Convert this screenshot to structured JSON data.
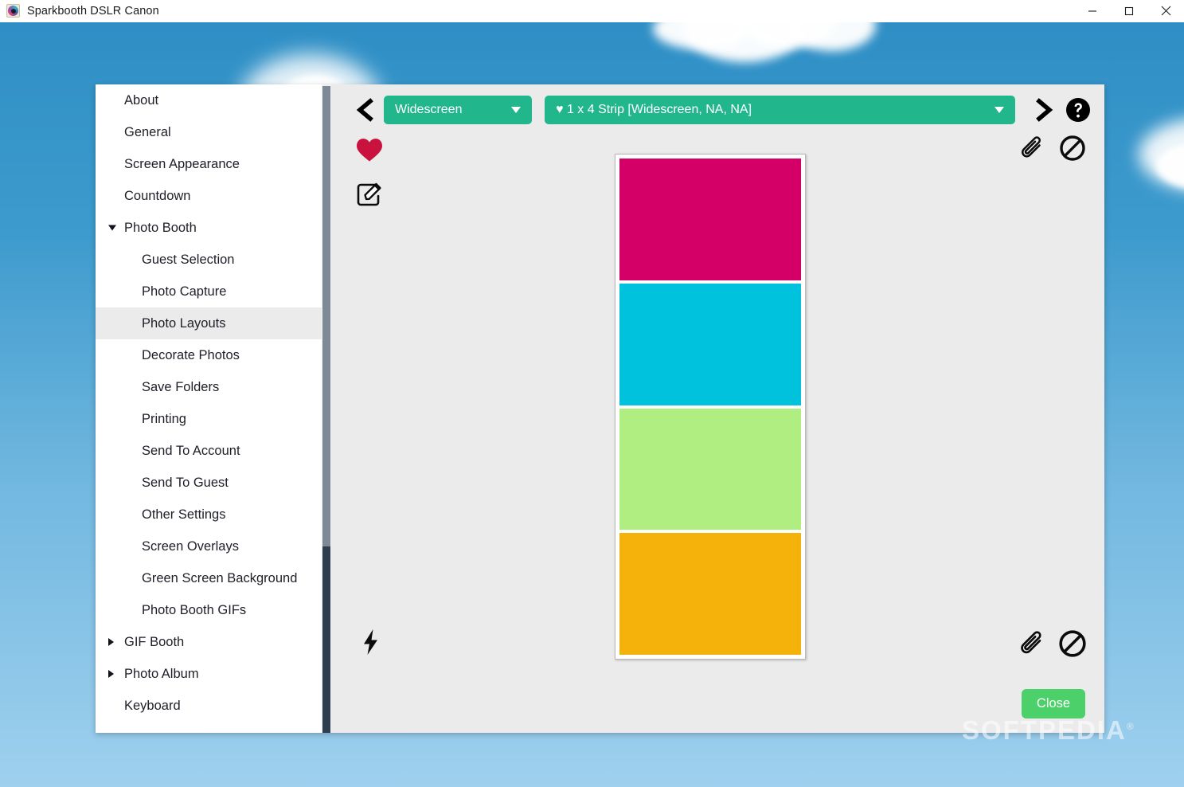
{
  "window": {
    "title": "Sparkbooth DSLR Canon",
    "app_icon": "camera-lens-icon",
    "controls": {
      "minimize": "minimize-icon",
      "maximize": "maximize-icon",
      "close": "close-icon"
    }
  },
  "sidebar": {
    "items": [
      {
        "label": "About",
        "level": 0,
        "expander": "none",
        "selected": false
      },
      {
        "label": "General",
        "level": 0,
        "expander": "none",
        "selected": false
      },
      {
        "label": "Screen Appearance",
        "level": 0,
        "expander": "none",
        "selected": false
      },
      {
        "label": "Countdown",
        "level": 0,
        "expander": "none",
        "selected": false
      },
      {
        "label": "Photo Booth",
        "level": 0,
        "expander": "expanded",
        "selected": false
      },
      {
        "label": "Guest Selection",
        "level": 1,
        "expander": "none",
        "selected": false
      },
      {
        "label": "Photo Capture",
        "level": 1,
        "expander": "none",
        "selected": false
      },
      {
        "label": "Photo Layouts",
        "level": 1,
        "expander": "none",
        "selected": true
      },
      {
        "label": "Decorate Photos",
        "level": 1,
        "expander": "none",
        "selected": false
      },
      {
        "label": "Save Folders",
        "level": 1,
        "expander": "none",
        "selected": false
      },
      {
        "label": "Printing",
        "level": 1,
        "expander": "none",
        "selected": false
      },
      {
        "label": "Send To Account",
        "level": 1,
        "expander": "none",
        "selected": false
      },
      {
        "label": "Send To Guest",
        "level": 1,
        "expander": "none",
        "selected": false
      },
      {
        "label": "Other Settings",
        "level": 1,
        "expander": "none",
        "selected": false
      },
      {
        "label": "Screen Overlays",
        "level": 1,
        "expander": "none",
        "selected": false
      },
      {
        "label": "Green Screen Background",
        "level": 1,
        "expander": "none",
        "selected": false
      },
      {
        "label": "Photo Booth GIFs",
        "level": 1,
        "expander": "none",
        "selected": false
      },
      {
        "label": "GIF Booth",
        "level": 0,
        "expander": "collapsed",
        "selected": false
      },
      {
        "label": "Photo Album",
        "level": 0,
        "expander": "collapsed",
        "selected": false
      },
      {
        "label": "Keyboard",
        "level": 0,
        "expander": "none",
        "selected": false
      }
    ]
  },
  "toolbar": {
    "back_icon": "chevron-left-icon",
    "mode_select": {
      "value": "Widescreen",
      "caret": "chevron-down-icon"
    },
    "layout_select": {
      "value": "♥ 1 x 4 Strip [Widescreen, NA, NA]",
      "caret": "chevron-down-icon"
    },
    "forward_icon": "chevron-right-icon",
    "help_icon": "help-circle-icon"
  },
  "left_tools": [
    {
      "name": "favorite-heart-icon",
      "color": "#c9133e"
    },
    {
      "name": "edit-layout-icon",
      "color": "#111111"
    }
  ],
  "right_tools_top": [
    {
      "name": "attach-paperclip-icon"
    },
    {
      "name": "disable-prohibited-icon"
    }
  ],
  "bottom_left_tools": [
    {
      "name": "lightning-bolt-icon"
    }
  ],
  "bottom_right_tools": [
    {
      "name": "attach-paperclip-icon"
    },
    {
      "name": "disable-prohibited-icon"
    }
  ],
  "footer": {
    "close_label": "Close",
    "close_color": "#4bd06a"
  },
  "preview": {
    "layout_name": "1 x 4 Strip",
    "frame_color": "#ffffff",
    "cells": [
      {
        "index": 1,
        "color": "#d40068"
      },
      {
        "index": 2,
        "color": "#00c2dd"
      },
      {
        "index": 3,
        "color": "#b0ee82"
      },
      {
        "index": 4,
        "color": "#f4b20b"
      }
    ]
  },
  "watermark": {
    "text": "SOFTPEDIA",
    "mark": "®"
  },
  "theme": {
    "select_green": "#22b68c",
    "panel_gray": "#ebebeb",
    "sidebar_white": "#ffffff",
    "scrollbar_thumb": "#7d8a96",
    "scrollbar_lower": "#2e3f50",
    "desktop_blue": "#2d8dc4"
  }
}
